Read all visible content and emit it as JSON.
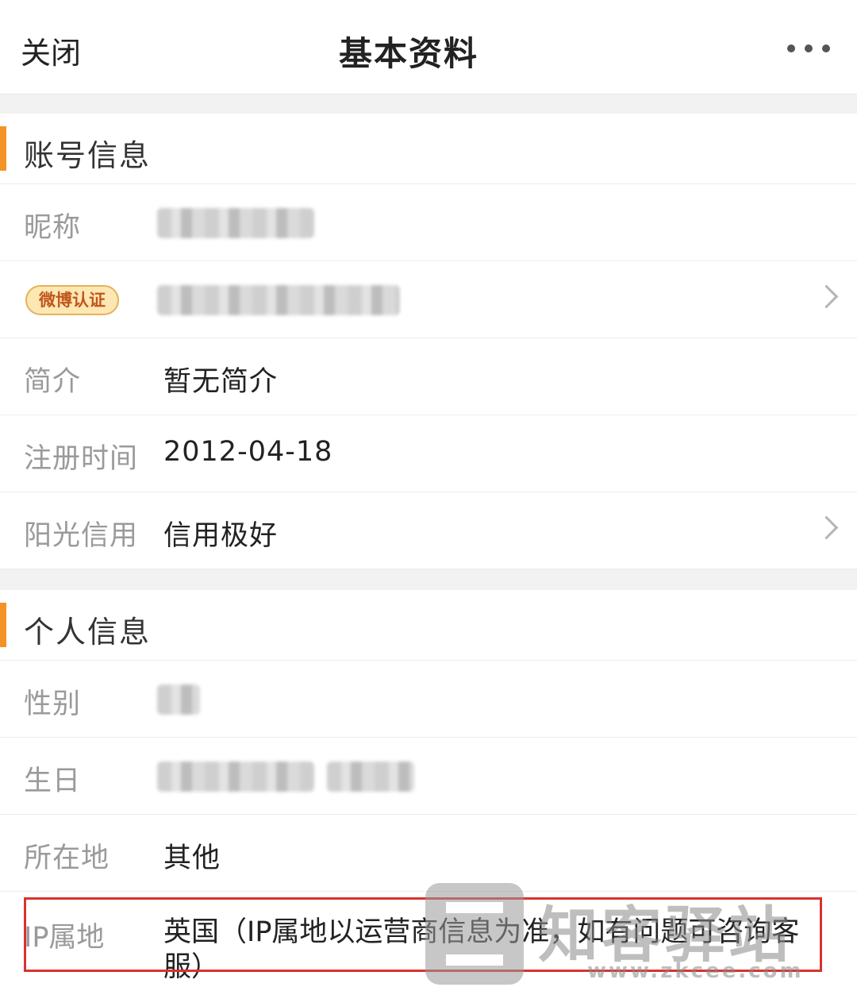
{
  "header": {
    "close_label": "关闭",
    "title": "基本资料"
  },
  "sections": {
    "account": {
      "title": "账号信息",
      "nickname_label": "昵称",
      "verify_badge": "微博认证",
      "bio_label": "简介",
      "bio_value": "暂无简介",
      "register_label": "注册时间",
      "register_value": "2012-04-18",
      "credit_label": "阳光信用",
      "credit_value": "信用极好"
    },
    "personal": {
      "title": "个人信息",
      "gender_label": "性别",
      "birthday_label": "生日",
      "location_label": "所在地",
      "location_value": "其他",
      "ip_label": "IP属地",
      "ip_value": "英国（IP属地以运营商信息为准，如有问题可咨询客服）"
    }
  },
  "watermark": {
    "brand": "知客驿站",
    "url": "www.zkcee.com"
  },
  "colors": {
    "accent_bar": "#f39325",
    "highlight_box": "#d8332f"
  },
  "icons": {
    "more": "more-dots-icon",
    "chevron": "chevron-right-icon"
  }
}
